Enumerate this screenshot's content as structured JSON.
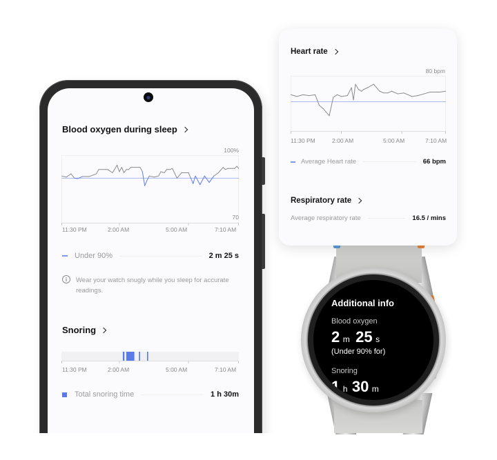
{
  "phone": {
    "blood_oxygen": {
      "title": "Blood oxygen during sleep",
      "y_max_label": "100%",
      "y_min_label": "70",
      "x_ticks": [
        "11:30 PM",
        "2:00 AM",
        "5:00 AM",
        "7:10 AM"
      ],
      "threshold_label": "Under 90%",
      "threshold_value": "2 m 25 s",
      "info_text": "Wear your watch snugly while you sleep for accurate readings.",
      "series_color": "#8a8a8a",
      "below_color": "#5b7be8",
      "threshold_color": "#a9b8f0"
    },
    "snoring": {
      "title": "Snoring",
      "x_ticks": [
        "11:30 PM",
        "2:00 AM",
        "5:00 AM",
        "7:10 AM"
      ],
      "total_label": "Total snoring time",
      "total_value": "1 h 30m",
      "bar_color": "#5b7be8"
    }
  },
  "popup": {
    "heart_rate": {
      "title": "Heart rate",
      "y_max_label": "80 bpm",
      "x_ticks": [
        "11:30 PM",
        "2:00 AM",
        "5:00 AM",
        "7:10 AM"
      ],
      "avg_label": "Average Heart rate",
      "avg_value": "66 bpm"
    },
    "respiratory": {
      "title": "Respiratory rate",
      "avg_label": "Average respiratory rate",
      "avg_value": "16.5 / mins"
    }
  },
  "watch": {
    "title": "Additional info",
    "blood_oxygen_label": "Blood oxygen",
    "blood_oxygen_min": "2",
    "blood_oxygen_min_unit": "m",
    "blood_oxygen_sec": "25",
    "blood_oxygen_sec_unit": "s",
    "blood_oxygen_note": "(Under 90% for)",
    "snoring_label": "Snoring",
    "snoring_hours": "1",
    "snoring_hours_unit": "h",
    "snoring_min": "30",
    "snoring_min_unit": "m"
  },
  "chart_data": [
    {
      "type": "line",
      "title": "Blood oxygen during sleep",
      "x_ticks": [
        "11:30 PM",
        "2:00 AM",
        "5:00 AM",
        "7:10 AM"
      ],
      "ylim": [
        70,
        100
      ],
      "threshold": 90,
      "x_hours": [
        0,
        0.2,
        0.4,
        0.55,
        0.7,
        0.9,
        1.2,
        1.5,
        1.6,
        1.7,
        2.0,
        2.2,
        2.4,
        2.5,
        2.6,
        2.7,
        2.8,
        2.9,
        3.0,
        3.2,
        3.4,
        3.5,
        3.6,
        3.7,
        3.8,
        4.0,
        4.2,
        4.3,
        4.45,
        4.55,
        4.6,
        4.7,
        4.8,
        5.0,
        5.2,
        5.4,
        5.5,
        5.6,
        5.7,
        5.8,
        6.0,
        6.2,
        6.4,
        6.6,
        6.8,
        7.0,
        7.1,
        7.2,
        7.3,
        7.4,
        7.5,
        7.6,
        7.67
      ],
      "values": [
        91,
        90.5,
        92,
        90,
        89.8,
        90.8,
        90.8,
        92,
        94,
        94,
        94,
        92.5,
        96,
        93,
        95,
        92.5,
        94,
        94,
        95,
        95,
        95,
        93,
        86.5,
        89,
        91,
        90.5,
        91,
        93,
        92.5,
        94,
        94,
        94,
        94.5,
        90,
        92.5,
        92.5,
        92.5,
        90,
        87.5,
        91,
        87,
        91,
        88,
        91,
        92.5,
        95,
        94,
        94.5,
        94.5,
        94.5,
        94.5,
        95.5,
        94.5
      ]
    },
    {
      "type": "line",
      "title": "Heart rate",
      "x_ticks": [
        "11:30 PM",
        "2:00 AM",
        "5:00 AM",
        "7:10 AM"
      ],
      "ylim": [
        50,
        80
      ],
      "average": 66,
      "x_hours": [
        0,
        0.3,
        0.6,
        0.9,
        1.2,
        1.4,
        1.6,
        1.9,
        2.1,
        2.3,
        2.5,
        2.8,
        3.0,
        3.1,
        3.2,
        3.35,
        3.5,
        3.6,
        3.8,
        4.1,
        4.4,
        4.6,
        4.8,
        5.0,
        5.3,
        5.6,
        6.0,
        6.3,
        6.6,
        6.9,
        7.2,
        7.4,
        7.67
      ],
      "values": [
        70,
        69,
        70,
        69.5,
        70,
        64,
        62,
        58,
        68.5,
        70,
        69,
        69.5,
        74,
        67,
        76,
        73,
        72,
        73,
        74,
        76,
        72,
        71,
        71,
        72,
        70.5,
        71,
        69,
        69.5,
        70.5,
        71.5,
        71.5,
        71.5,
        72
      ]
    },
    {
      "type": "bar",
      "title": "Snoring",
      "x_ticks": [
        "11:30 PM",
        "2:00 AM",
        "5:00 AM",
        "7:10 AM"
      ],
      "segments_hours": [
        [
          2.65,
          2.72
        ],
        [
          2.8,
          3.15
        ],
        [
          3.35,
          3.4
        ],
        [
          3.7,
          3.75
        ]
      ]
    }
  ]
}
